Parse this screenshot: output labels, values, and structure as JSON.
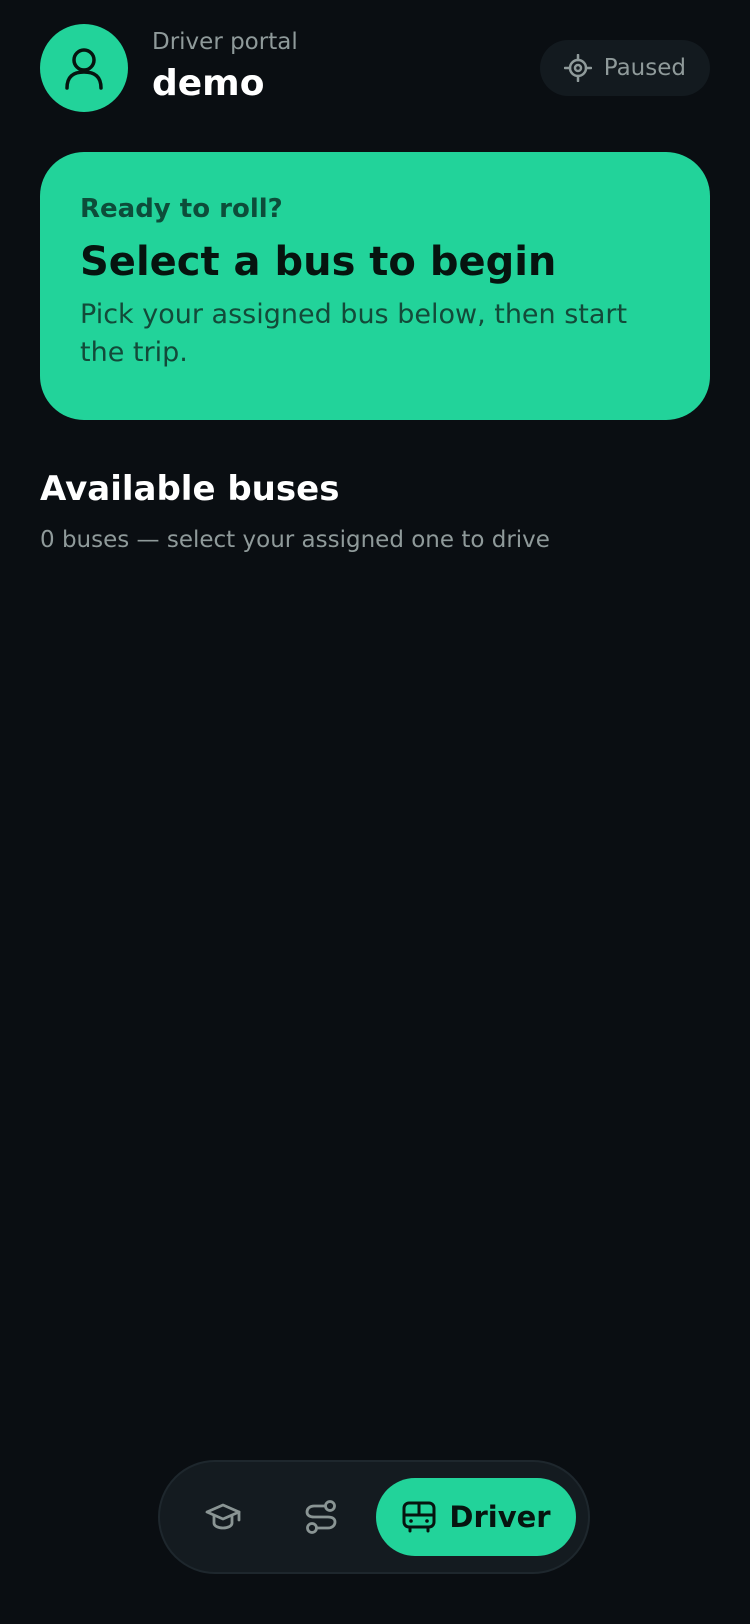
{
  "colors": {
    "accent": "#22d39a",
    "background": "#0a0e12",
    "muted_text": "#8f9a9a"
  },
  "header": {
    "portal_label": "Driver portal",
    "user_name": "demo",
    "avatar_icon": "user-icon",
    "status": {
      "icon": "location-target-icon",
      "label": "Paused"
    }
  },
  "hero": {
    "eyebrow": "Ready to roll?",
    "title": "Select a bus to begin",
    "subtitle": "Pick your assigned bus below, then start the trip."
  },
  "buses_section": {
    "title": "Available buses",
    "subtitle": "0 buses — select your assigned one to drive",
    "items": []
  },
  "bottom_nav": {
    "items": [
      {
        "icon": "graduation-cap-icon",
        "label": "",
        "active": false
      },
      {
        "icon": "route-icon",
        "label": "",
        "active": false
      },
      {
        "icon": "bus-icon",
        "label": "Driver",
        "active": true
      }
    ]
  }
}
